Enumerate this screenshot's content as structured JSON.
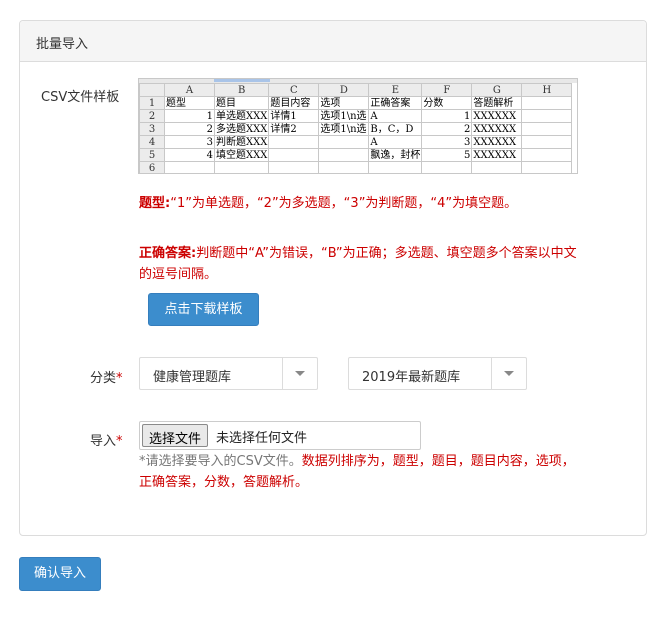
{
  "panel": {
    "title": "批量导入"
  },
  "csv_sample": {
    "label": "CSV文件样板",
    "columns": [
      "",
      "A",
      "B",
      "C",
      "D",
      "E",
      "F",
      "G",
      "H"
    ],
    "rows": [
      [
        "1",
        "题型",
        "题目",
        "题目内容",
        "选项",
        "正确答案",
        "分数",
        "答题解析",
        ""
      ],
      [
        "2",
        "1",
        "单选题XXX",
        "详情1",
        "选项1\\n选",
        "A",
        "1",
        "XXXXXX",
        ""
      ],
      [
        "3",
        "2",
        "多选题XXX",
        "详情2",
        "选项1\\n选",
        "B，C，D",
        "2",
        "XXXXXX",
        ""
      ],
      [
        "4",
        "3",
        "判断题XXX",
        "",
        "",
        "A",
        "3",
        "XXXXXX",
        ""
      ],
      [
        "5",
        "4",
        "填空题XXX",
        "",
        "",
        "飘逸，封杯",
        "5",
        "XXXXXX",
        ""
      ],
      [
        "6",
        "",
        "",
        "",
        "",
        "",
        "",
        "",
        ""
      ]
    ]
  },
  "notes": {
    "type_label": "题型:",
    "type_text": "“1”为单选题，“2”为多选题，“3”为判断题，“4”为填空题。",
    "answer_label": "正确答案:",
    "answer_text": "判断题中“A”为错误，“B”为正确；多选题、填空题多个答案以中文的逗号间隔。"
  },
  "download_button": "点击下载样板",
  "category": {
    "label": "分类",
    "required_mark": "*",
    "select1": "健康管理题库",
    "select2": "2019年最新题库"
  },
  "import": {
    "label": "导入",
    "required_mark": "*",
    "choose_button": "选择文件",
    "file_status": "未选择任何文件",
    "hint_grey": "*请选择要导入的CSV文件。",
    "hint_red": "数据列排序为，题型，题目，题目内容，选项，正确答案，分数，答题解析。"
  },
  "confirm_button": "确认导入"
}
